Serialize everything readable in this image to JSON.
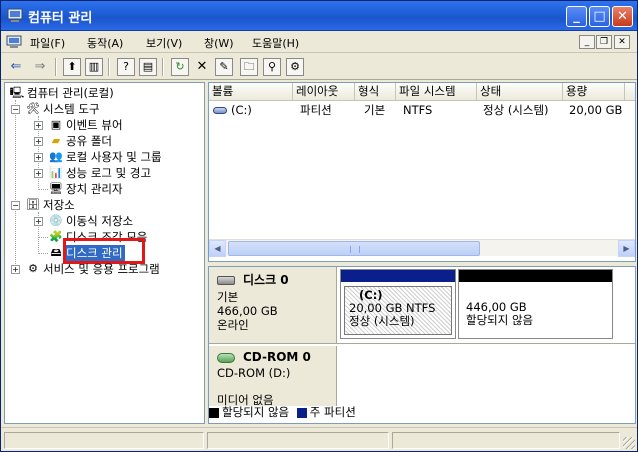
{
  "window": {
    "title": "컴퓨터 관리"
  },
  "menu": [
    {
      "label": "파일(F)"
    },
    {
      "label": "동작(A)"
    },
    {
      "label": "보기(V)"
    },
    {
      "label": "창(W)"
    },
    {
      "label": "도움말(H)"
    }
  ],
  "tree": {
    "root": "컴퓨터 관리(로컬)",
    "system_tools": "시스템 도구",
    "event_viewer": "이벤트 뷰어",
    "shared_folders": "공유 폴더",
    "local_users": "로컬 사용자 및 그룹",
    "perf_logs": "성능 로그 및 경고",
    "device_manager": "장치 관리자",
    "storage": "저장소",
    "removable": "이동식 저장소",
    "defrag": "디스크 조각 모음",
    "disk_mgmt": "디스크 관리",
    "services": "서비스 및 응용 프로그램"
  },
  "volume_table": {
    "columns": [
      "볼륨",
      "레이아웃",
      "형식",
      "파일 시스템",
      "상태",
      "용량"
    ],
    "rows": [
      [
        "(C:)",
        "파티션",
        "기본",
        "NTFS",
        "정상 (시스템)",
        "20,00 GB"
      ]
    ]
  },
  "disks": {
    "disk0": {
      "name": "디스크 0",
      "type": "기본",
      "size": "466,00 GB",
      "status": "온라인",
      "partitions": [
        {
          "label": "(C:)",
          "size": "20,00 GB NTFS",
          "state": "정상 (시스템)"
        },
        {
          "label": "",
          "size": "446,00 GB",
          "state": "할당되지 않음"
        }
      ]
    },
    "cdrom0": {
      "name": "CD-ROM 0",
      "type": "CD-ROM (D:)",
      "media": "미디어 없음"
    }
  },
  "legend": {
    "unallocated": "할당되지 않음",
    "primary": "주 파티션"
  },
  "colors": {
    "primary_partition": "#0a1e8c",
    "unallocated": "#000000",
    "selection": "#316ac5",
    "highlight_box": "#e01818"
  }
}
